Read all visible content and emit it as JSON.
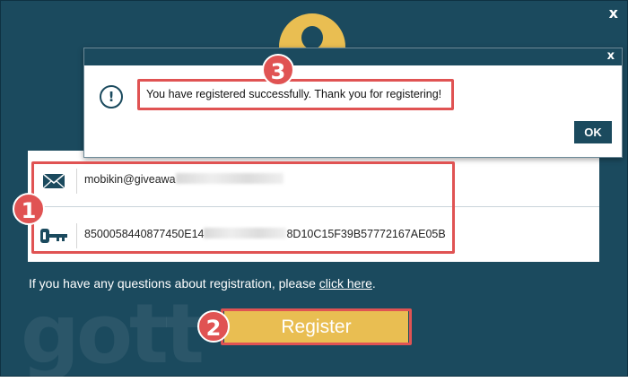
{
  "window": {
    "close_glyph": "x"
  },
  "logo": {
    "icon": "user-avatar-icon",
    "color": "#e9be52"
  },
  "watermark": {
    "text": "gott"
  },
  "form": {
    "email": {
      "icon": "envelope-icon",
      "visible_text": "mobikin@giveawa"
    },
    "code": {
      "icon": "key-icon",
      "visible_prefix": "8500058440877450E14",
      "visible_suffix": "8D10C15F39B57772167AE05B"
    }
  },
  "help": {
    "text": "If you have any questions about registration, please ",
    "link_label": "click here",
    "suffix": "."
  },
  "register_button": {
    "label": "Register"
  },
  "dialog": {
    "close_glyph": "x",
    "icon": "info-icon",
    "icon_glyph": "!",
    "message": "You have registered successfully. Thank you for registering!",
    "ok_label": "OK"
  },
  "annotations": {
    "badge_1": "1",
    "badge_2": "2",
    "badge_3": "3",
    "color": "#e05353"
  },
  "colors": {
    "background": "#1b4a5e",
    "accent": "#e9be52",
    "callout": "#e05353"
  }
}
